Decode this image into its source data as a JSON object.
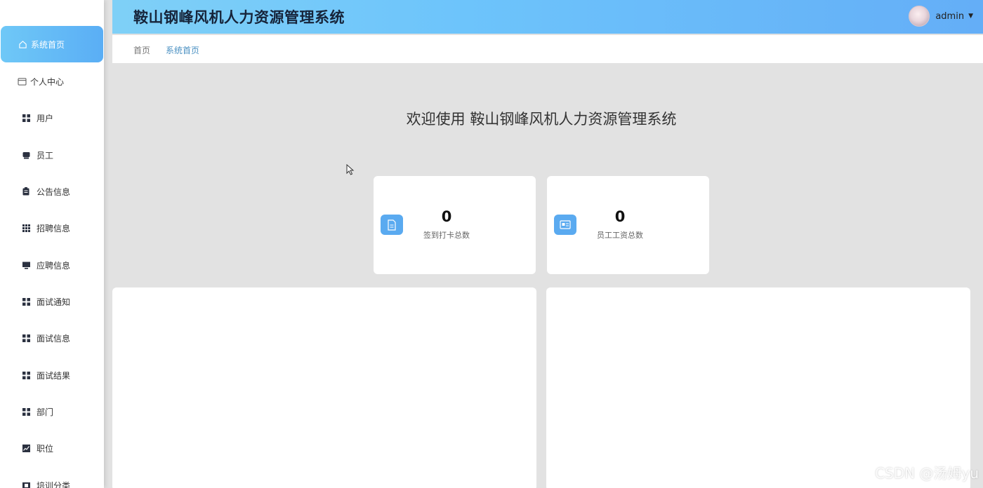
{
  "header": {
    "title": "鞍山钢峰风机人力资源管理系统",
    "username": "admin"
  },
  "sidebar": {
    "items": [
      {
        "label": "系统首页",
        "icon": "home-icon"
      },
      {
        "label": "个人中心",
        "icon": "card-icon"
      },
      {
        "label": "用户",
        "icon": "grid-icon"
      },
      {
        "label": "员工",
        "icon": "box-icon"
      },
      {
        "label": "公告信息",
        "icon": "clipboard-icon"
      },
      {
        "label": "招聘信息",
        "icon": "grid9-icon"
      },
      {
        "label": "应聘信息",
        "icon": "monitor-icon"
      },
      {
        "label": "面试通知",
        "icon": "grid-icon"
      },
      {
        "label": "面试信息",
        "icon": "grid-icon"
      },
      {
        "label": "面试结果",
        "icon": "grid-icon"
      },
      {
        "label": "部门",
        "icon": "grid-icon"
      },
      {
        "label": "职位",
        "icon": "chart-icon"
      },
      {
        "label": "培训分类",
        "icon": "film-icon"
      }
    ]
  },
  "breadcrumb": {
    "home": "首页",
    "current": "系统首页"
  },
  "main": {
    "welcome": "欢迎使用 鞍山钢峰风机人力资源管理系统",
    "stats": [
      {
        "value": "0",
        "label": "签到打卡总数",
        "icon": "document-icon"
      },
      {
        "value": "0",
        "label": "员工工资总数",
        "icon": "id-card-icon"
      }
    ]
  },
  "watermark": "CSDN @汤姆yu",
  "colors": {
    "accent": "#5aaef5",
    "header_start": "#7fd0f7",
    "header_end": "#64aef7",
    "page_bg": "#e2e2e2"
  }
}
